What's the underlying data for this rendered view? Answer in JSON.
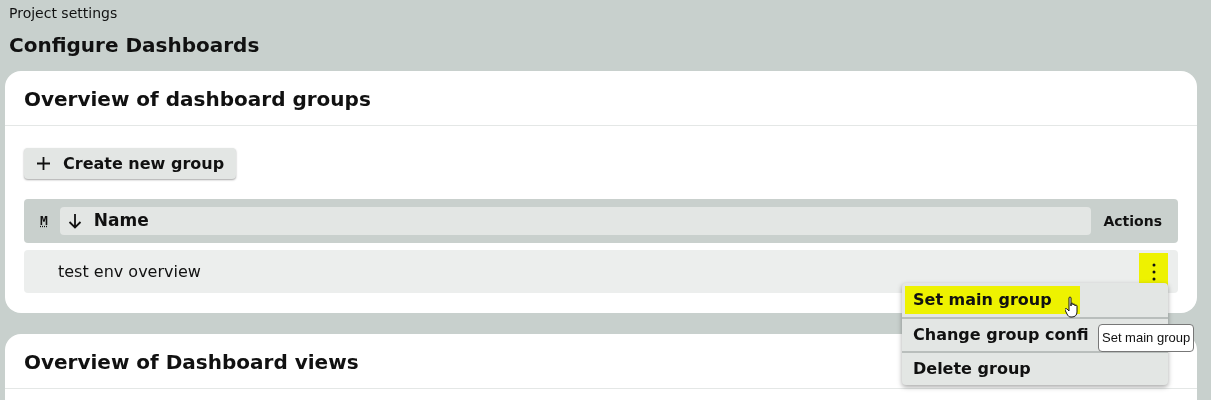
{
  "breadcrumb": "Project settings",
  "title": "Configure Dashboards",
  "groups_card": {
    "title": "Overview of dashboard groups",
    "create_button": "Create new group",
    "table": {
      "columns": [
        {
          "label": "M",
          "kind": "marker"
        },
        {
          "label": "Name",
          "kind": "sortable"
        },
        {
          "label": "Actions",
          "kind": "plain"
        }
      ],
      "rows": [
        {
          "name": "test env overview",
          "menu_highlighted": true
        }
      ]
    },
    "menu": {
      "items": [
        {
          "label": "Set main group",
          "highlighted": true
        },
        {
          "label": "Change group confi",
          "highlighted": false
        },
        {
          "label": "Delete group",
          "highlighted": false
        }
      ]
    },
    "tooltip": "Set main group"
  },
  "views_card": {
    "title": "Overview of Dashboard views"
  }
}
